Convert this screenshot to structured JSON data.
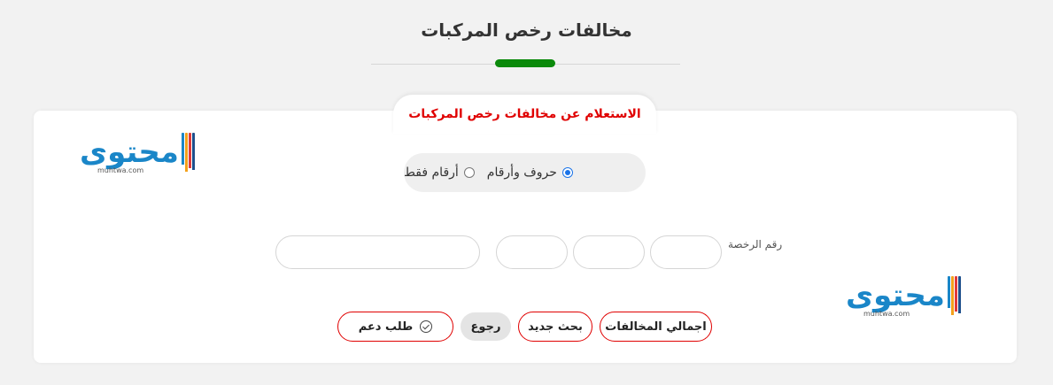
{
  "page": {
    "title": "مخالفات رخص المركبات",
    "accent_color": "#0b8a0b"
  },
  "card": {
    "tab_title": "الاستعلام عن مخالفات رخص المركبات",
    "tab_title_color": "#e00000"
  },
  "logo": {
    "word": "محتوى",
    "site": "muhtwa.com"
  },
  "type_options": {
    "selected": "حروف وأرقام",
    "options": [
      "حروف وأرقام",
      "أرقام فقط"
    ]
  },
  "license": {
    "label": "رقم الرخصة",
    "fields": [
      "",
      "",
      "",
      ""
    ]
  },
  "buttons": {
    "total": "اجمالي المخالفات",
    "new_search": "بحث جديد",
    "back": "رجوع",
    "support": "طلب دعم"
  }
}
